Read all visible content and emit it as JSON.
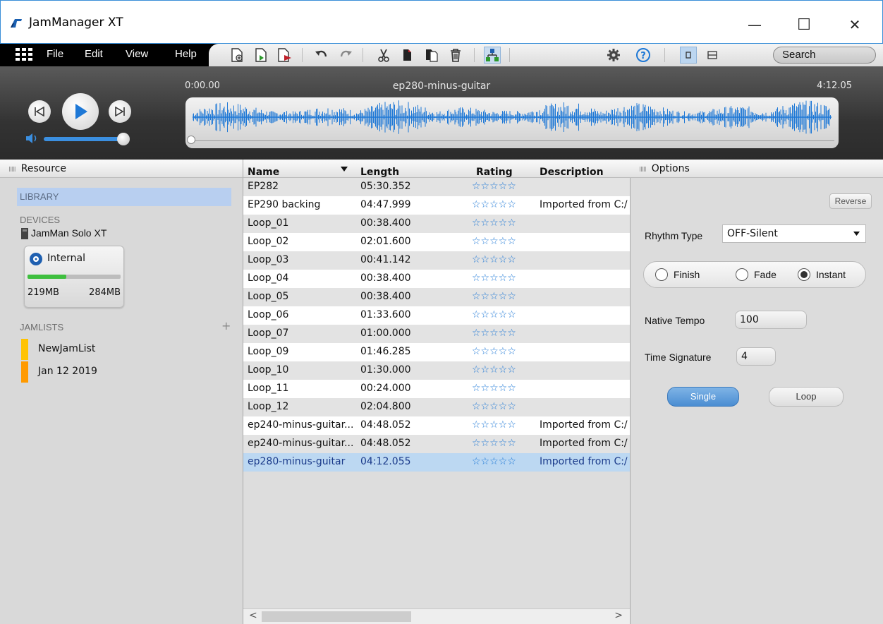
{
  "window": {
    "title": "JamManager XT",
    "minimize": "—",
    "maximize": "☐",
    "close": "✕"
  },
  "menu": {
    "items": [
      "File",
      "Edit",
      "View",
      "Help"
    ],
    "search": "Search"
  },
  "toolbar": {
    "icons": [
      "new-file-icon",
      "import-icon",
      "export-icon",
      "undo-icon",
      "redo-icon",
      "cut-icon",
      "copy-icon",
      "paste-icon",
      "delete-icon",
      "device-sync-icon",
      "settings-icon",
      "help-icon",
      "single-view-icon",
      "split-view-icon"
    ]
  },
  "transport": {
    "time_start": "0:00.00",
    "track_name": "ep280-minus-guitar",
    "time_end": "4:12.05",
    "volume_level": 0.92,
    "position_level": 0.0
  },
  "resource": {
    "header": "Resource",
    "library": "LIBRARY",
    "devices_label": "DEVICES",
    "device_name": "JamMan Solo XT",
    "internal": {
      "label": "Internal",
      "used": "219MB",
      "total": "284MB",
      "used_fraction": 0.42
    },
    "jamlists_label": "JAMLISTS",
    "jamlists_add": "+",
    "jamlists": [
      {
        "label": "NewJamList",
        "color": "#ffc300"
      },
      {
        "label": "Jan 12 2019",
        "color": "#ff9a00"
      }
    ]
  },
  "table": {
    "columns": {
      "name": "Name",
      "length": "Length",
      "rating": "Rating",
      "description": "Description"
    },
    "rows": [
      {
        "name": "EP282",
        "length": "05:30.352",
        "rating": "☆☆☆☆☆",
        "description": ""
      },
      {
        "name": "EP290 backing",
        "length": "04:47.999",
        "rating": "☆☆☆☆☆",
        "description": "Imported from C:/"
      },
      {
        "name": "Loop_01",
        "length": "00:38.400",
        "rating": "☆☆☆☆☆",
        "description": ""
      },
      {
        "name": "Loop_02",
        "length": "02:01.600",
        "rating": "☆☆☆☆☆",
        "description": ""
      },
      {
        "name": "Loop_03",
        "length": "00:41.142",
        "rating": "☆☆☆☆☆",
        "description": ""
      },
      {
        "name": "Loop_04",
        "length": "00:38.400",
        "rating": "☆☆☆☆☆",
        "description": ""
      },
      {
        "name": "Loop_05",
        "length": "00:38.400",
        "rating": "☆☆☆☆☆",
        "description": ""
      },
      {
        "name": "Loop_06",
        "length": "01:33.600",
        "rating": "☆☆☆☆☆",
        "description": ""
      },
      {
        "name": "Loop_07",
        "length": "01:00.000",
        "rating": "☆☆☆☆☆",
        "description": ""
      },
      {
        "name": "Loop_09",
        "length": "01:46.285",
        "rating": "☆☆☆☆☆",
        "description": ""
      },
      {
        "name": "Loop_10",
        "length": "01:30.000",
        "rating": "☆☆☆☆☆",
        "description": ""
      },
      {
        "name": "Loop_11",
        "length": "00:24.000",
        "rating": "☆☆☆☆☆",
        "description": ""
      },
      {
        "name": "Loop_12",
        "length": "02:04.800",
        "rating": "☆☆☆☆☆",
        "description": ""
      },
      {
        "name": "ep240-minus-guitar...",
        "length": "04:48.052",
        "rating": "☆☆☆☆☆",
        "description": "Imported from C:/"
      },
      {
        "name": "ep240-minus-guitar...",
        "length": "04:48.052",
        "rating": "☆☆☆☆☆",
        "description": "Imported from C:/"
      },
      {
        "name": "ep280-minus-guitar",
        "length": "04:12.055",
        "rating": "☆☆☆☆☆",
        "description": "Imported from C:/"
      }
    ],
    "selected_index": 15,
    "scroll_left": "<",
    "scroll_right": ">"
  },
  "options": {
    "header": "Options",
    "reverse": "Reverse",
    "rhythm_type_label": "Rhythm Type",
    "rhythm_type_value": "OFF-Silent",
    "stop_modes": [
      "Finish",
      "Fade",
      "Instant"
    ],
    "stop_mode_selected": "Instant",
    "native_tempo_label": "Native Tempo",
    "native_tempo_value": "100",
    "time_signature_label": "Time Signature",
    "time_signature_value": "4",
    "single": "Single",
    "loop": "Loop",
    "play_mode_selected": "Single"
  },
  "colors": {
    "accent": "#1e78d6",
    "selected_row": "#bcd8f2",
    "library_highlight": "#b8cff0",
    "single_button": "#5b9ad6"
  }
}
